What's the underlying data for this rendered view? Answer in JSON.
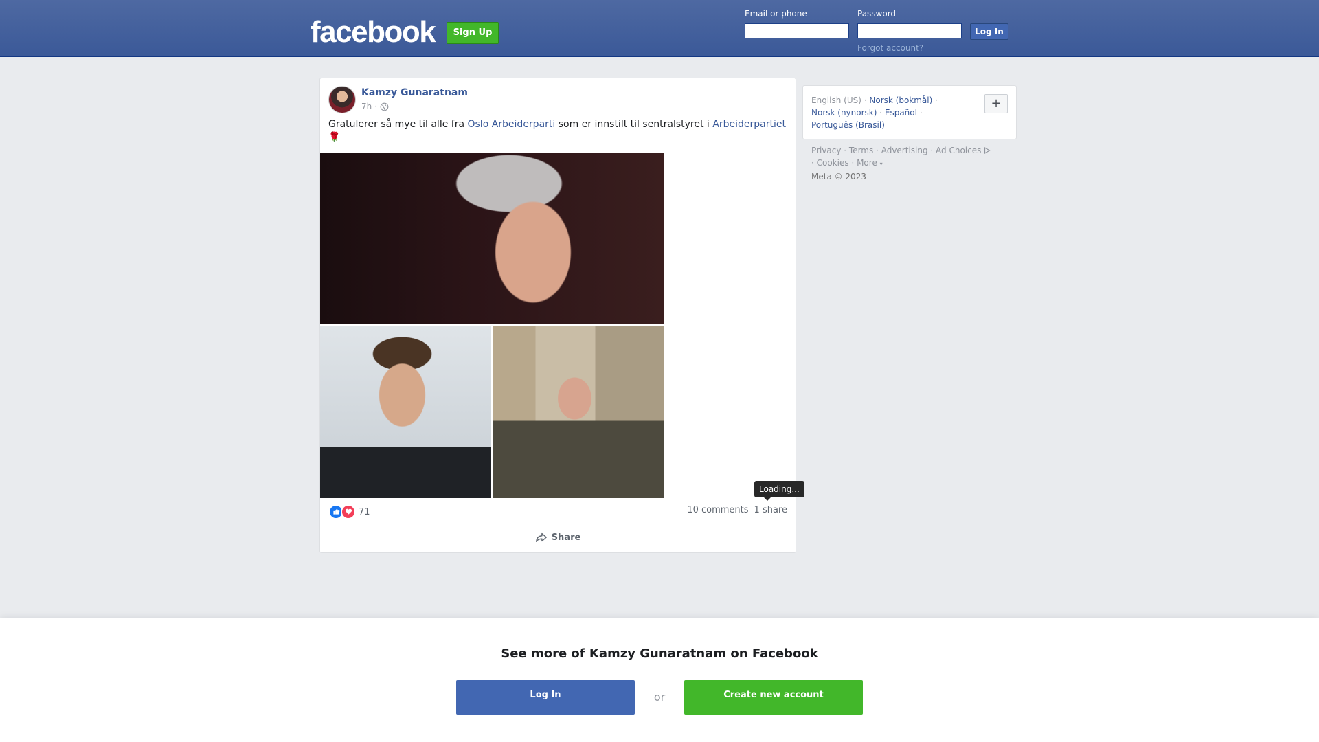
{
  "header": {
    "logo": "facebook",
    "signup_label": "Sign Up",
    "email_label": "Email or phone",
    "password_label": "Password",
    "login_label": "Log In",
    "forgot_label": "Forgot account?"
  },
  "post": {
    "author": "Kamzy Gunaratnam",
    "time": "7h",
    "audience_icon": "globe-icon",
    "text_before": "Gratulerer så mye til alle fra ",
    "link1": "Oslo Arbeiderparti",
    "text_middle": " som er innstilt til sentralstyret i ",
    "link2": "Arbeiderpartiet",
    "emoji": "🌹",
    "reactions_count": "71",
    "comments": "10 comments",
    "shares": "1 share",
    "tooltip": "Loading...",
    "share_label": "Share"
  },
  "languages": {
    "current": "English (US)",
    "items": [
      "Norsk (bokmål)",
      "Norsk (nynorsk)",
      "Español",
      "Português (Brasil)"
    ],
    "more_icon": "plus-icon"
  },
  "footer": {
    "links": [
      "Privacy",
      "Terms",
      "Advertising",
      "Ad Choices",
      "Cookies",
      "More"
    ],
    "copyright": "Meta © 2023"
  },
  "banner": {
    "title": "See more of Kamzy Gunaratnam on Facebook",
    "login_label": "Log In",
    "or_label": "or",
    "create_label": "Create new account"
  },
  "colors": {
    "brand_blue": "#3b5998",
    "link_blue": "#385898",
    "green": "#42b72a",
    "page_bg": "#e9ebee"
  }
}
